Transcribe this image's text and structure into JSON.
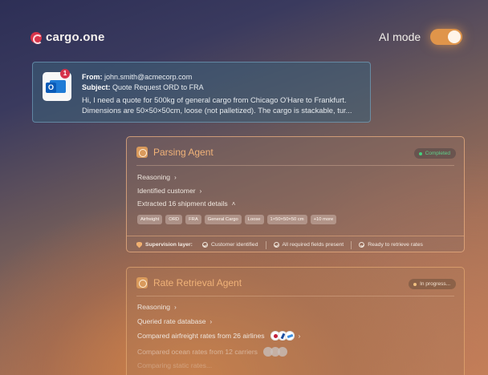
{
  "header": {
    "brand": "cargo.one",
    "ai_mode_label": "AI mode",
    "ai_mode_on": true
  },
  "email": {
    "from_label": "From:",
    "from": "john.smith@acmecorp.com",
    "subject_label": "Subject:",
    "subject": "Quote Request ORD to FRA",
    "body_line1": "Hi, I need a quote for 500kg of general cargo from Chicago O'Hare to Frankfurt.",
    "body_line2": "Dimensions are 50×50×50cm, loose (not palletized). The cargo is stackable, tur...",
    "unread_count": "1",
    "icon": "outlook-icon"
  },
  "parsing_agent": {
    "title": "Parsing Agent",
    "status": "Completed",
    "status_color": "#45d07e",
    "steps": [
      "Reasoning",
      "Identified customer",
      "Extracted 16 shipment details"
    ],
    "chips": [
      "Airfreight",
      "ORD",
      "FRA",
      "General Cargo",
      "Loose",
      "1×50×50×50 cm",
      "+10 more"
    ],
    "supervision": {
      "label": "Supervision layer:",
      "checks": [
        "Customer identified",
        "All required fields present",
        "Ready to retrieve rates"
      ]
    }
  },
  "rate_agent": {
    "title": "Rate Retrieval Agent",
    "status": "In progress...",
    "steps": [
      "Reasoning",
      "Queried rate database",
      "Compared airfreight rates from 26 airlines",
      "Compared ocean rates from 12 carriers",
      "Comparing static rates..."
    ]
  },
  "colors": {
    "accent": "#e0954a",
    "agent_title": "#f0b278",
    "brand_mark": "#d7344a"
  }
}
